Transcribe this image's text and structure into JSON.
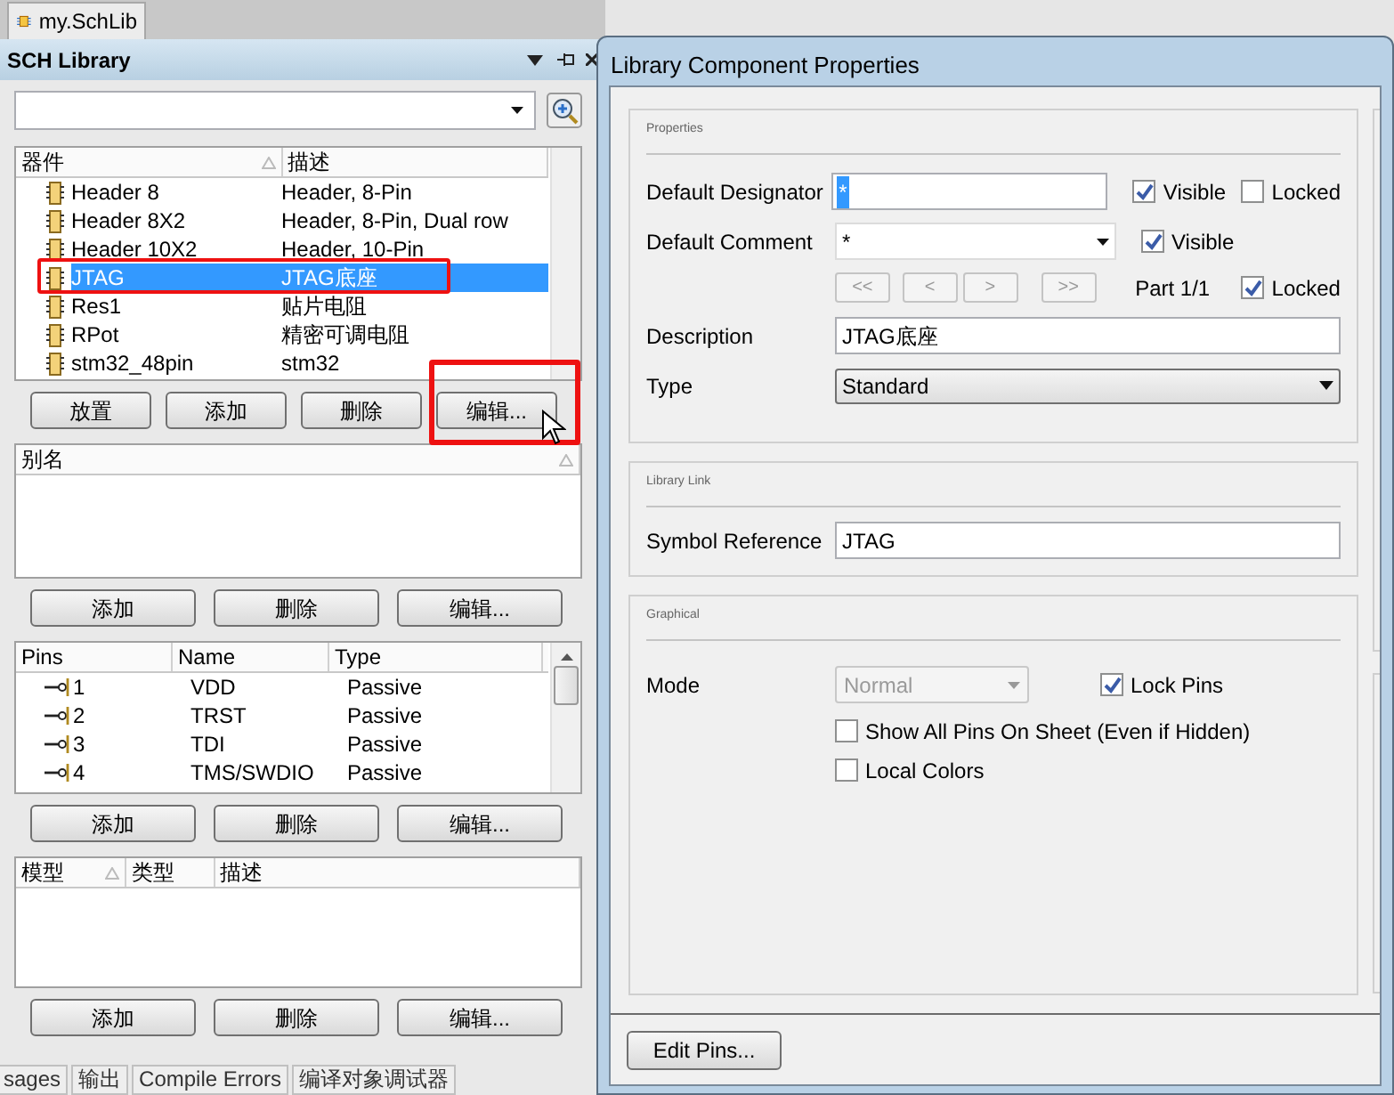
{
  "document_tab": {
    "label": "my.SchLib",
    "selected": true
  },
  "panel": {
    "title": "SCH Library"
  },
  "components": {
    "columns": [
      "器件",
      "描述"
    ],
    "rows": [
      {
        "name": "Header 8",
        "description": "Header, 8-Pin",
        "selected": false
      },
      {
        "name": "Header 8X2",
        "description": "Header, 8-Pin, Dual row",
        "selected": false
      },
      {
        "name": "Header 10X2",
        "description": "Header, 10-Pin",
        "selected": false
      },
      {
        "name": "JTAG",
        "description": "JTAG底座",
        "selected": true
      },
      {
        "name": "Res1",
        "description": "贴片电阻",
        "selected": false
      },
      {
        "name": "RPot",
        "description": "精密可调电阻",
        "selected": false
      },
      {
        "name": "stm32_48pin",
        "description": "stm32",
        "selected": false
      }
    ]
  },
  "component_buttons": [
    "放置",
    "添加",
    "删除",
    "编辑..."
  ],
  "aliases": {
    "columns": [
      "别名"
    ]
  },
  "alias_buttons": [
    "添加",
    "删除",
    "编辑..."
  ],
  "pins": {
    "columns": [
      "Pins",
      "Name",
      "Type"
    ],
    "rows": [
      {
        "number": "1",
        "name": "VDD",
        "type": "Passive"
      },
      {
        "number": "2",
        "name": "TRST",
        "type": "Passive"
      },
      {
        "number": "3",
        "name": "TDI",
        "type": "Passive"
      },
      {
        "number": "4",
        "name": "TMS/SWDIO",
        "type": "Passive"
      }
    ]
  },
  "pin_buttons": [
    "添加",
    "删除",
    "编辑..."
  ],
  "models": {
    "columns": [
      "模型",
      "类型",
      "描述"
    ]
  },
  "model_buttons": [
    "添加",
    "删除",
    "编辑..."
  ],
  "bottom_tabs": [
    "sages",
    "输出",
    "Compile Errors",
    "编译对象调试器"
  ],
  "dialog": {
    "title": "Library Component Properties",
    "properties": {
      "heading": "Properties",
      "designator": {
        "label": "Default Designator",
        "value": "*",
        "visible_label": "Visible",
        "visible": true,
        "locked_label": "Locked",
        "locked": false
      },
      "comment": {
        "label": "Default Comment",
        "value": "*",
        "visible_label": "Visible",
        "visible": true
      },
      "nav_buttons": [
        "<<",
        "<",
        ">",
        ">>"
      ],
      "part": "Part 1/1",
      "part_locked_label": "Locked",
      "part_locked": true,
      "description": {
        "label": "Description",
        "value": "JTAG底座"
      },
      "type": {
        "label": "Type",
        "value": "Standard"
      }
    },
    "library_link": {
      "heading": "Library Link",
      "symbol_reference": {
        "label": "Symbol Reference",
        "value": "JTAG"
      }
    },
    "graphical": {
      "heading": "Graphical",
      "mode": {
        "label": "Mode",
        "value": "Normal",
        "disabled": true
      },
      "lock_pins": {
        "label": "Lock Pins",
        "checked": true
      },
      "options": [
        {
          "label": "Show All Pins On Sheet (Even if Hidden)",
          "checked": false
        },
        {
          "label": "Local Colors",
          "checked": false
        }
      ]
    },
    "footer_button": "Edit Pins..."
  }
}
